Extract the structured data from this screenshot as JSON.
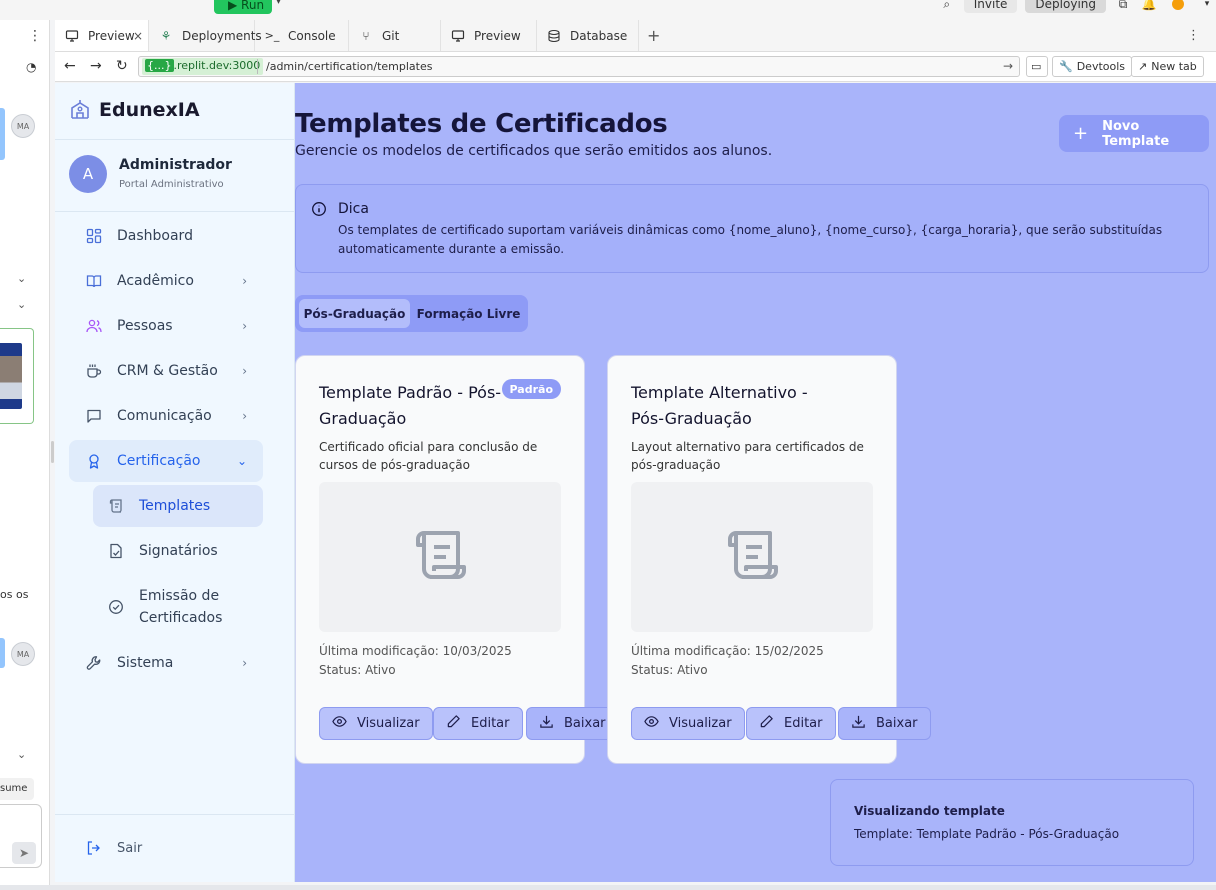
{
  "ide": {
    "run_label": "Run",
    "invite_label": "Invite",
    "deploy_label": "Deploying",
    "tabs": [
      {
        "label": "Preview",
        "icon": "monitor-icon"
      },
      {
        "label": "Deployments",
        "icon": "deploy-icon"
      },
      {
        "label": "Console",
        "icon": "terminal-icon"
      },
      {
        "label": "Git",
        "icon": "git-icon"
      },
      {
        "label": "Preview",
        "icon": "monitor-icon"
      },
      {
        "label": "Database",
        "icon": "database-icon"
      }
    ],
    "left_strip": {
      "avatar_initials": "MA",
      "partial_text": "os os",
      "input_text": "sume"
    }
  },
  "browser": {
    "url_host_badge": "{...}",
    "url_host": ".replit.dev:3000",
    "url_path": "/admin/certification/templates",
    "devtools_label": "Devtools",
    "newtab_label": "New tab"
  },
  "sidebar": {
    "brand": "EdunexIA",
    "user": {
      "initial": "A",
      "name": "Administrador",
      "role": "Portal Administrativo"
    },
    "items": [
      {
        "label": "Dashboard"
      },
      {
        "label": "Acadêmico"
      },
      {
        "label": "Pessoas"
      },
      {
        "label": "CRM & Gestão"
      },
      {
        "label": "Comunicação"
      },
      {
        "label": "Certificação"
      },
      {
        "label": "Sistema"
      }
    ],
    "sub_items": [
      {
        "label": "Templates"
      },
      {
        "label": "Signatários"
      },
      {
        "label": "Emissão de Certificados"
      }
    ],
    "logout_label": "Sair"
  },
  "main": {
    "title": "Templates de Certificados",
    "subtitle": "Gerencie os modelos de certificados que serão emitidos aos alunos.",
    "new_button": "Novo Template",
    "tip": {
      "title": "Dica",
      "text": "Os templates de certificado suportam variáveis dinâmicas como {nome_aluno}, {nome_curso}, {carga_horaria}, que serão substituídas automaticamente durante a emissão."
    },
    "tabs": [
      "Pós-Graduação",
      "Formação Livre"
    ],
    "cards": [
      {
        "title": "Template Padrão - Pós-Graduação",
        "badge": "Padrão",
        "description": "Certificado oficial para conclusão de cursos de pós-graduação",
        "modified": "Última modificação: 10/03/2025",
        "status": "Status: Ativo"
      },
      {
        "title": "Template Alternativo - Pós-Graduação",
        "badge": "",
        "description": "Layout alternativo para certificados de pós-graduação",
        "modified": "Última modificação: 15/02/2025",
        "status": "Status: Ativo"
      }
    ],
    "actions": {
      "view": "Visualizar",
      "edit": "Editar",
      "download": "Baixar"
    },
    "toast": {
      "title": "Visualizando template",
      "text": "Template: Template Padrão - Pós-Graduação"
    }
  },
  "colors": {
    "accent": "#8e9bf6",
    "main_bg": "#a9b4fa",
    "sidebar_bg": "#f0f8ff",
    "active_blue": "#2563eb"
  }
}
